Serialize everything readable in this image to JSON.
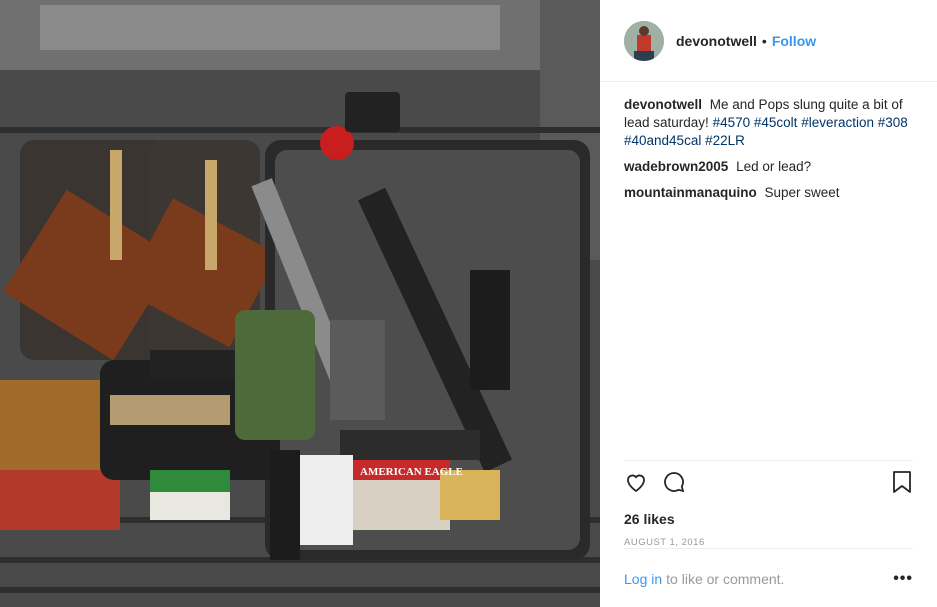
{
  "post": {
    "username": "devonotwell",
    "follow_label": "Follow",
    "separator": "•",
    "caption": {
      "username": "devonotwell",
      "text": "Me and Pops slung quite a bit of lead saturday!",
      "hashtags": [
        "#4570",
        "#45colt",
        "#leveraction",
        "#308",
        "#40and45cal",
        "#22LR"
      ]
    },
    "comments": [
      {
        "username": "wadebrown2005",
        "text": "Led or lead?"
      },
      {
        "username": "mountainmanaquino",
        "text": "Super sweet"
      }
    ],
    "likes": "26 likes",
    "date": "AUGUST 1, 2016",
    "login_link": "Log in",
    "login_text": "to like or comment.",
    "more_label": "•••",
    "image": {
      "ammo_box_text": "AMERICAN EAGLE"
    }
  },
  "colors": {
    "link_blue": "#3897f0",
    "hashtag": "#003569",
    "text": "#262626",
    "muted": "#999999"
  },
  "icons": [
    "heart-icon",
    "comment-icon",
    "bookmark-icon",
    "more-options-icon"
  ]
}
